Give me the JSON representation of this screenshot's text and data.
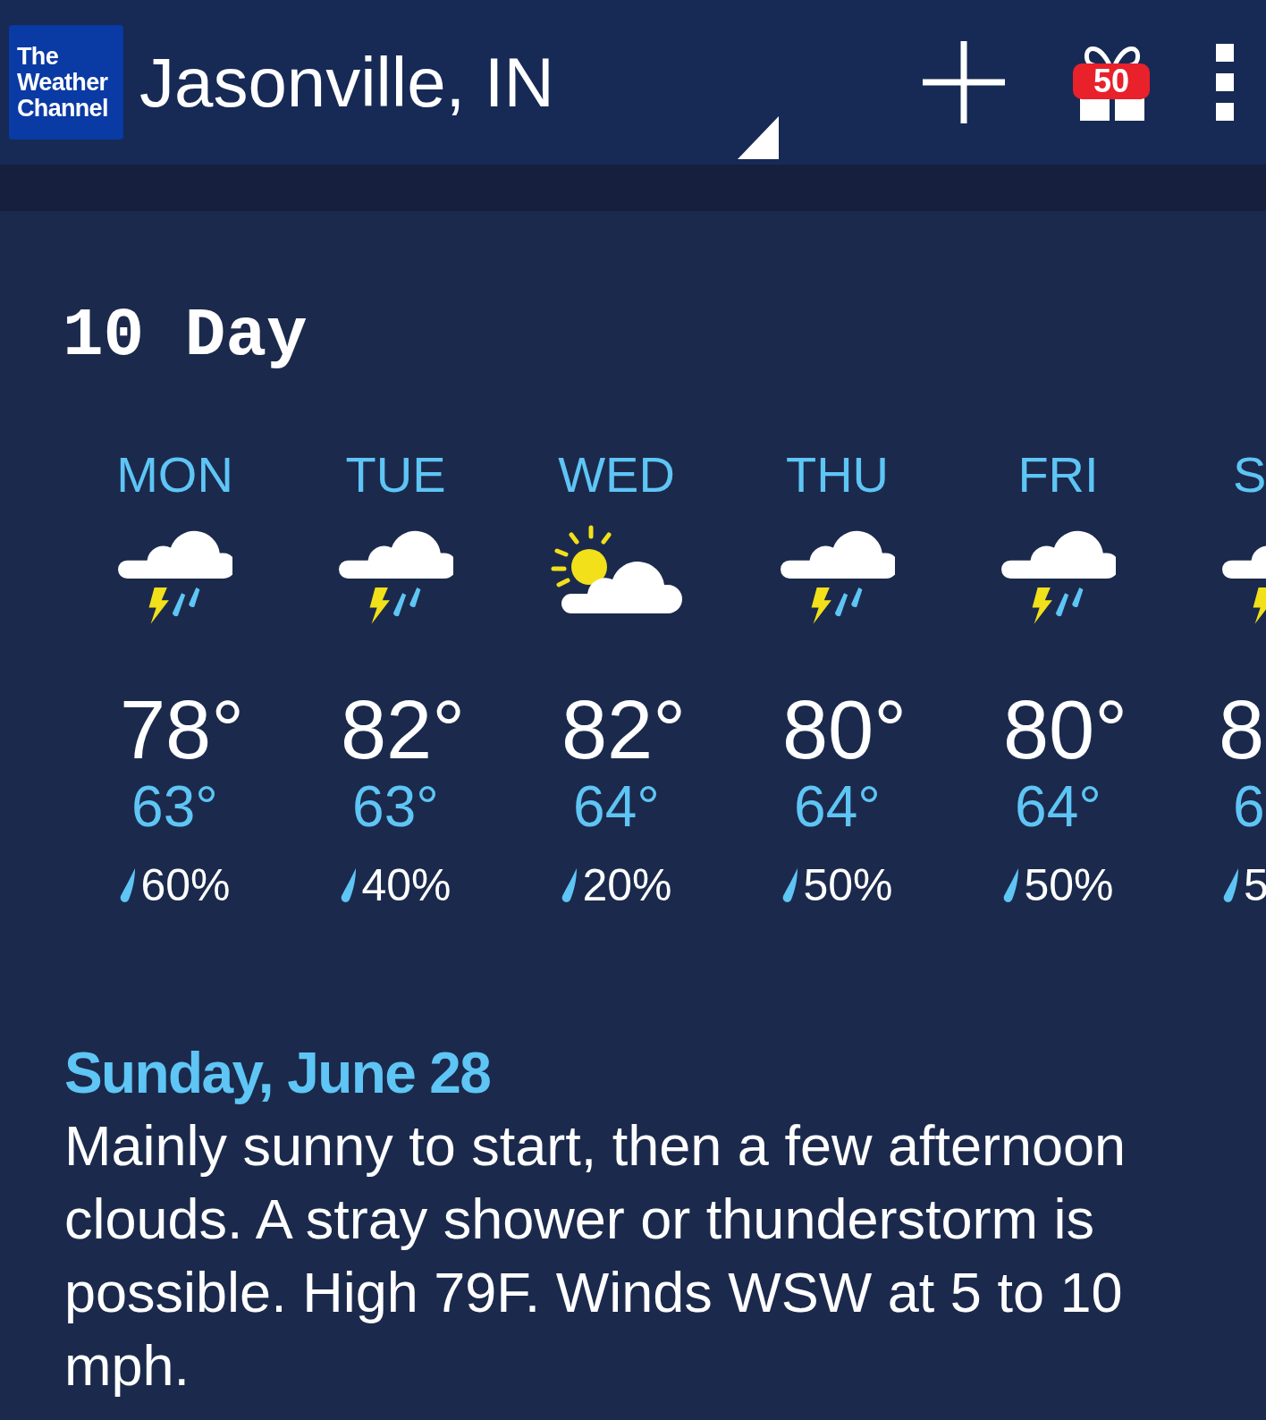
{
  "header": {
    "logo": [
      "The",
      "Weather",
      "Channel"
    ],
    "location": "Jasonville, IN",
    "gift_badge": "50"
  },
  "section_title": "10 Day",
  "days": [
    {
      "day": "MON",
      "kind": "storm",
      "high": "78°",
      "low": "63°",
      "precip": "60%"
    },
    {
      "day": "TUE",
      "kind": "storm",
      "high": "82°",
      "low": "63°",
      "precip": "40%"
    },
    {
      "day": "WED",
      "kind": "partly_sunny",
      "high": "82°",
      "low": "64°",
      "precip": "20%"
    },
    {
      "day": "THU",
      "kind": "storm",
      "high": "80°",
      "low": "64°",
      "precip": "50%"
    },
    {
      "day": "FRI",
      "kind": "storm",
      "high": "80°",
      "low": "64°",
      "precip": "50%"
    },
    {
      "day": "S",
      "kind": "storm",
      "high": "8",
      "low": "6",
      "precip": "5"
    }
  ],
  "detail": {
    "date": "Sunday, June 28",
    "text": "Mainly sunny to start, then a few afternoon clouds. A stray shower or thunderstorm is possible. High 79F. Winds WSW at 5 to 10 mph."
  }
}
